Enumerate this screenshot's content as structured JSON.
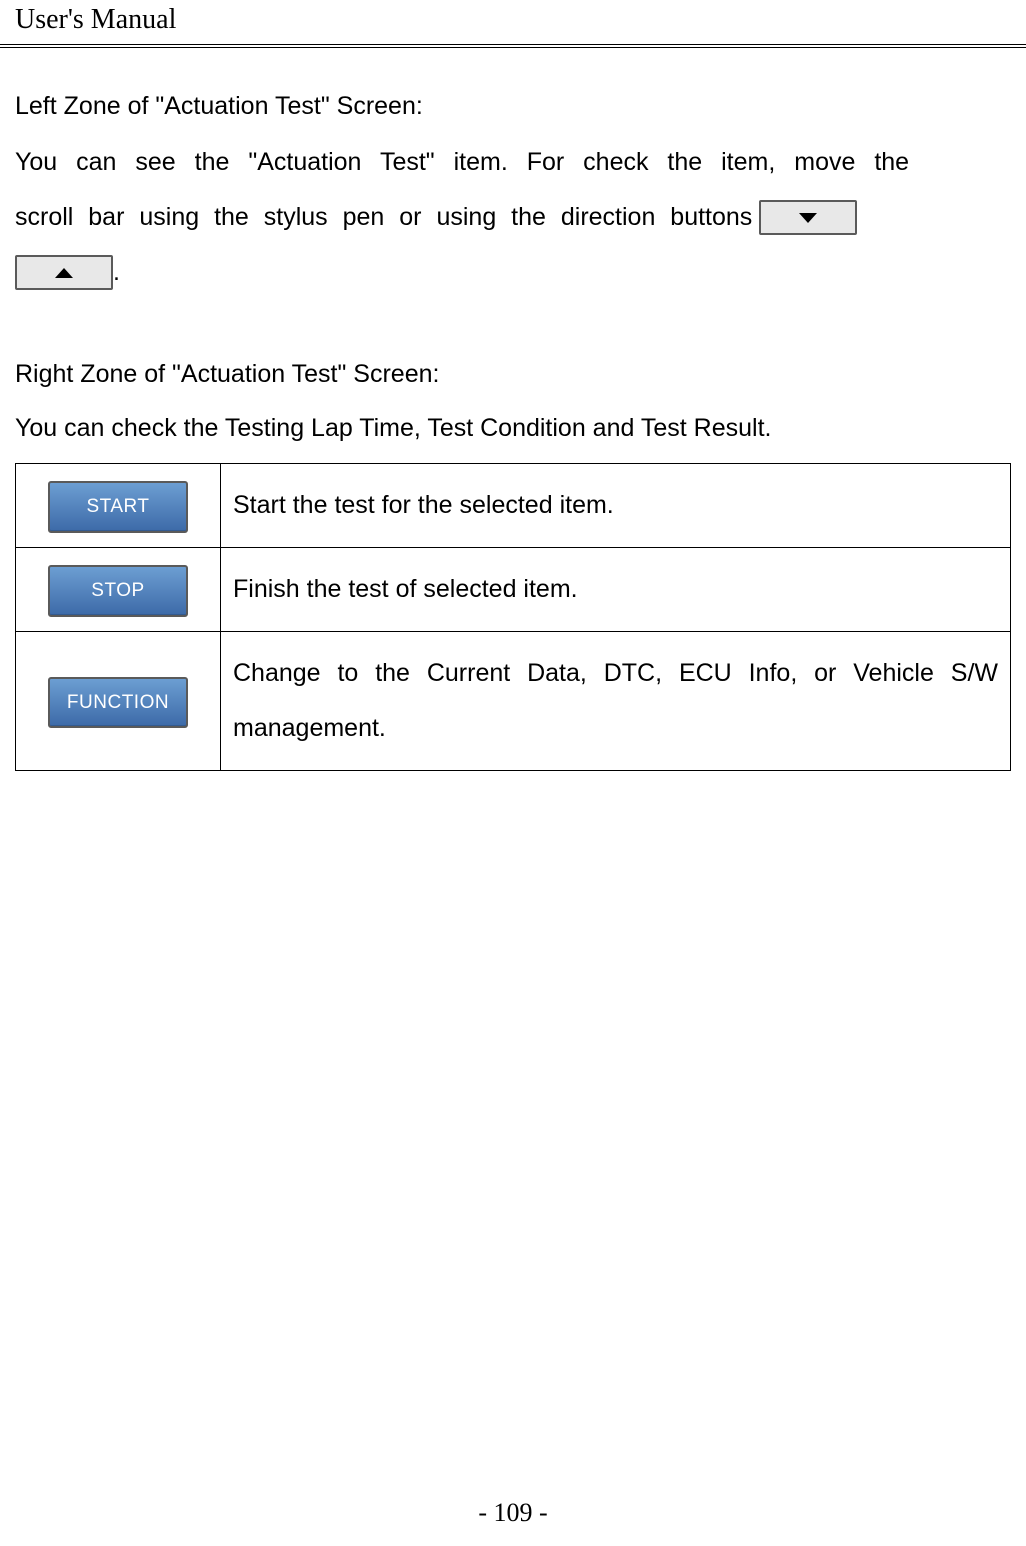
{
  "header": {
    "title": "User's Manual"
  },
  "sections": {
    "leftZone": {
      "heading": "Left Zone of \"Actuation Test\" Screen:",
      "para_line1": "You can see the \"Actuation Test\" item. For check the item, move the",
      "para_line2_pre": "scroll bar using the stylus pen or using the direction buttons",
      "period": "."
    },
    "rightZone": {
      "heading": "Right Zone of \"Actuation Test\" Screen:",
      "para": "You can check the Testing Lap Time, Test Condition and Test Result."
    }
  },
  "table": {
    "rows": [
      {
        "button_label": "START",
        "description": "Start the test for the selected item."
      },
      {
        "button_label": "STOP",
        "description": "Finish the test of selected item."
      },
      {
        "button_label": "FUNCTION",
        "description": "Change to the Current Data, DTC, ECU Info, or Vehicle S/W management."
      }
    ]
  },
  "footer": {
    "page_number": "- 109 -"
  }
}
